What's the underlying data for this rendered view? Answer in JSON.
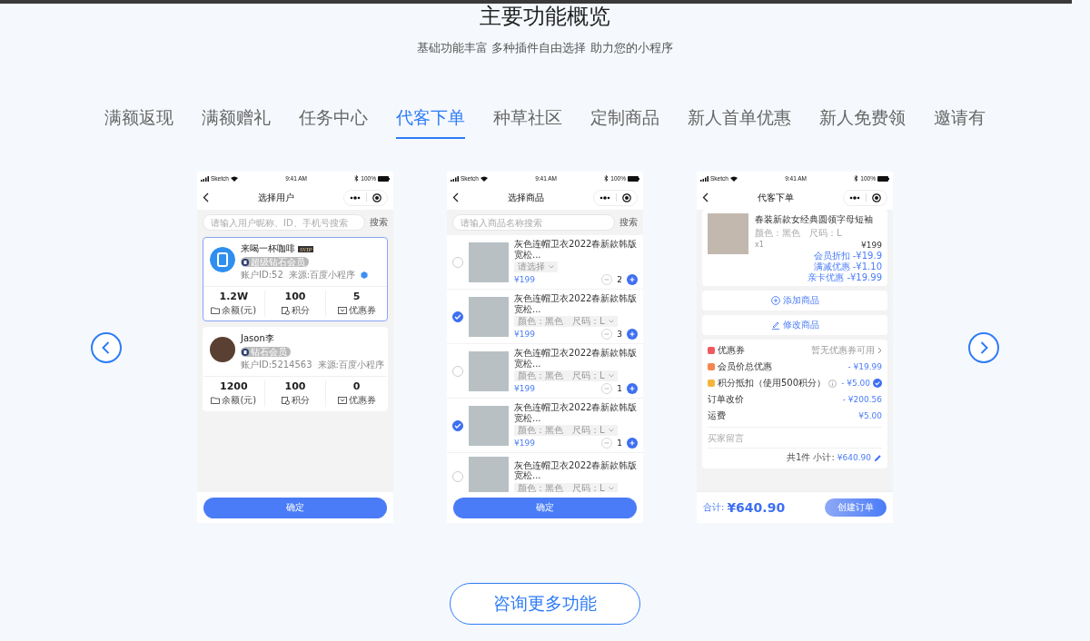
{
  "section": {
    "title": "主要功能概览",
    "subtitle": "基础功能丰富 多种插件自由选择 助力您的小程序"
  },
  "tabs": [
    {
      "label": "满额返现",
      "selected": false
    },
    {
      "label": "满额赠礼",
      "selected": false
    },
    {
      "label": "任务中心",
      "selected": false
    },
    {
      "label": "代客下单",
      "selected": true
    },
    {
      "label": "种草社区",
      "selected": false
    },
    {
      "label": "定制商品",
      "selected": false
    },
    {
      "label": "新人首单优惠",
      "selected": false
    },
    {
      "label": "新人免费领",
      "selected": false
    },
    {
      "label": "邀请有",
      "selected": false
    }
  ],
  "phones": [
    {
      "kind": "users",
      "status": {
        "carrier": "Sketch",
        "time": "9:41 AM",
        "battery": "100%"
      },
      "title": "选择用户",
      "search": {
        "placeholder": "请输入用户昵称、ID、手机号搜索",
        "button": "搜索"
      },
      "users": [
        {
          "kind": "logo",
          "name": "来喝一杯咖啡",
          "badge": "SVIP",
          "level": "超级钻石会员",
          "account": "账户ID:52",
          "source": "来源:百度小程序",
          "selected": true,
          "stats": [
            {
              "kind": "balance",
              "value": "1.2W",
              "label": "余额(元)"
            },
            {
              "kind": "points",
              "value": "100",
              "label": "积分"
            },
            {
              "kind": "coupon",
              "value": "5",
              "label": "优惠券"
            }
          ]
        },
        {
          "kind": "photo",
          "name": "Jason李",
          "level": "钻石会员",
          "account": "账户ID:5214563",
          "source": "来源:百度小程序",
          "selected": false,
          "stats": [
            {
              "kind": "balance",
              "value": "1200",
              "label": "余额(元)"
            },
            {
              "kind": "points",
              "value": "100",
              "label": "积分"
            },
            {
              "kind": "coupon",
              "value": "0",
              "label": "优惠券"
            }
          ]
        }
      ],
      "confirm": "确定"
    },
    {
      "kind": "products",
      "status": {
        "carrier": "Sketch",
        "time": "9:41 AM",
        "battery": "100%"
      },
      "title": "选择商品",
      "search": {
        "placeholder": "请输入商品名称搜索",
        "button": "搜索"
      },
      "products": [
        {
          "title": "灰色连帽卫衣2022春新款韩版宽松...",
          "spec": "请选择",
          "price": "¥199",
          "qty": "2",
          "checked": false
        },
        {
          "title": "灰色连帽卫衣2022春新款韩版宽松...",
          "spec": "颜色：黑色　尺码：L",
          "price": "¥199",
          "qty": "3",
          "checked": true
        },
        {
          "title": "灰色连帽卫衣2022春新款韩版宽松...",
          "spec": "颜色：黑色　尺码：L",
          "price": "¥199",
          "qty": "1",
          "checked": false
        },
        {
          "title": "灰色连帽卫衣2022春新款韩版宽松...",
          "spec": "颜色：黑色　尺码：L",
          "price": "¥199",
          "qty": "1",
          "checked": true
        },
        {
          "title": "灰色连帽卫衣2022春新款韩版宽松...",
          "spec": "颜色：黑色　尺码：L",
          "checked": false
        }
      ],
      "confirm": "确定"
    },
    {
      "kind": "order",
      "status": {
        "carrier": "Sketch",
        "time": "9:41 AM",
        "battery": "100%"
      },
      "title": "代客下单",
      "product": {
        "title": "春装新款女经典圆领字母短袖",
        "spec": "颜色：黑色　尺码：L",
        "qty": "x1",
        "price": "¥199",
        "discounts": [
          "会员折扣 -¥19.9",
          "满减优惠 -¥1.10",
          "亲卡优惠 -¥19.99"
        ]
      },
      "actions": [
        {
          "kind": "add",
          "label": "添加商品"
        },
        {
          "kind": "edit",
          "label": "修改商品"
        }
      ],
      "fees": [
        {
          "kind": "coupon",
          "label": "优惠券",
          "value": "暂无优惠券可用",
          "color": "#f0585e",
          "checked": false
        },
        {
          "kind": "discount",
          "label": "会员价总优惠",
          "value": "- ¥19.99",
          "color": "#f5874f",
          "checked": false
        },
        {
          "kind": "points",
          "label": "积分抵扣（使用500积分）",
          "value": "- ¥5.00",
          "color": "#f5b43a",
          "checked": true
        },
        {
          "kind": "plain",
          "label": "订单改价",
          "value": "- ¥200.56",
          "checked": false
        },
        {
          "kind": "plain",
          "label": "运费",
          "value": "¥5.00",
          "checked": false
        }
      ],
      "remark": {
        "placeholder": "买家留言"
      },
      "subtotal": {
        "count": "共1件",
        "label": "小计:",
        "value": "¥640.90"
      },
      "total": {
        "label": "合计:",
        "value": "¥640.90"
      },
      "submit": "创建订单"
    }
  ],
  "cta": "咨询更多功能"
}
